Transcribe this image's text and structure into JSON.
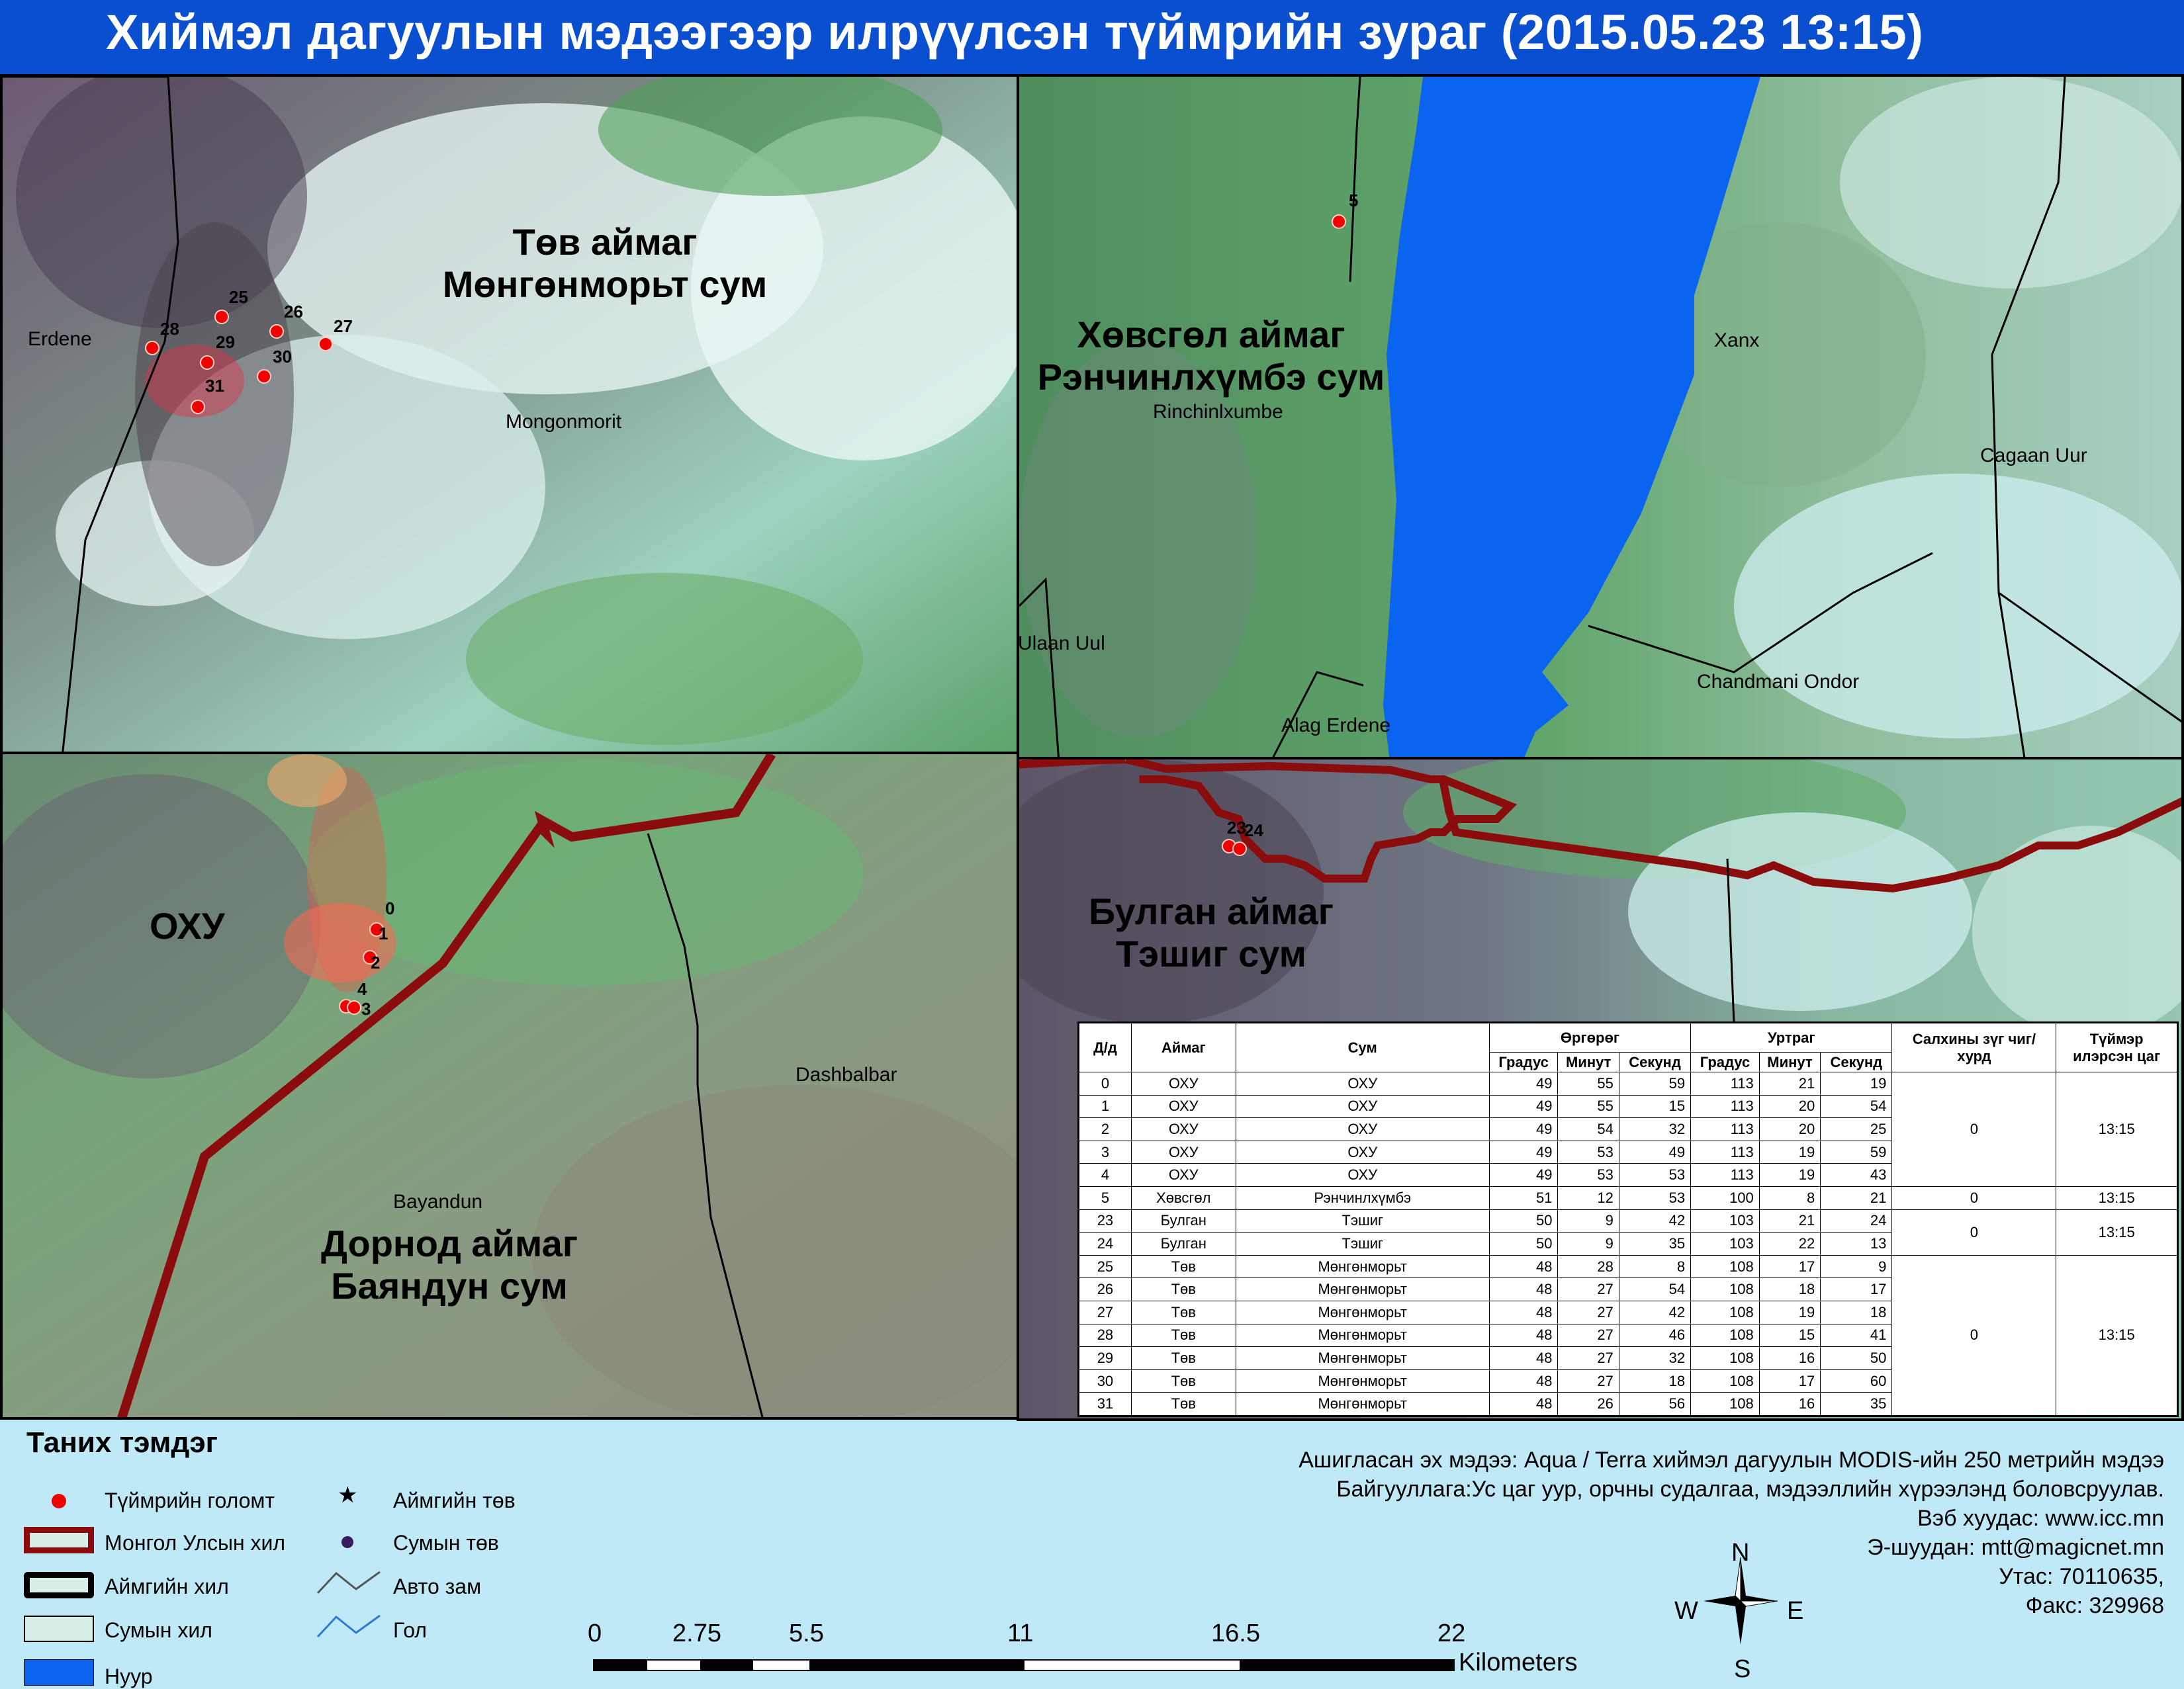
{
  "title": "Хиймэл дагуулын мэдээгээр илрүүлсэн түймрийн зураг  (2015.05.23 13:15)",
  "panels": {
    "tl": {
      "region": [
        "Төв аймаг",
        "Мөнгөнморьт сум"
      ],
      "places": [
        "Erdene",
        "Mongonmorit"
      ],
      "fires": [
        "25",
        "26",
        "27",
        "28",
        "29",
        "30",
        "31"
      ]
    },
    "tr": {
      "region": [
        "Хөвсгөл аймаг",
        "Рэнчинлхүмбэ сум"
      ],
      "places": [
        "Rinchinlxumbe",
        "Xanx",
        "Cagaan Uur",
        "Ulaan Uul",
        "Chandmani Ondor",
        "Alag Erdene"
      ],
      "fires": [
        "5"
      ]
    },
    "bl": {
      "region": [
        "Дорнод аймаг",
        "Баяндун сум"
      ],
      "country": "ОХУ",
      "places": [
        "Dashbalbar",
        "Bayandun"
      ],
      "fires": [
        "0",
        "1",
        "2",
        "4",
        "3"
      ]
    },
    "br": {
      "region": [
        "Булган аймаг",
        "Тэшиг сум"
      ],
      "fires": [
        "23",
        "24"
      ]
    }
  },
  "table": {
    "headers": {
      "dd": "Д/д",
      "aimag": "Аймаг",
      "sum": "Сум",
      "lat": "Өргөрөг",
      "lon": "Уртраг",
      "deg": "Градус",
      "min": "Минут",
      "sec": "Секунд",
      "wind": "Салхины зүг чиг/хурд",
      "time": "Түймэр илэрсэн цаг"
    },
    "rows": [
      [
        "0",
        "ОХУ",
        "ОХУ",
        "49",
        "55",
        "59",
        "113",
        "21",
        "19"
      ],
      [
        "1",
        "ОХУ",
        "ОХУ",
        "49",
        "55",
        "15",
        "113",
        "20",
        "54"
      ],
      [
        "2",
        "ОХУ",
        "ОХУ",
        "49",
        "54",
        "32",
        "113",
        "20",
        "25"
      ],
      [
        "3",
        "ОХУ",
        "ОХУ",
        "49",
        "53",
        "49",
        "113",
        "19",
        "59"
      ],
      [
        "4",
        "ОХУ",
        "ОХУ",
        "49",
        "53",
        "53",
        "113",
        "19",
        "43"
      ],
      [
        "5",
        "Хөвсгөл",
        "Рэнчинлхүмбэ",
        "51",
        "12",
        "53",
        "100",
        "8",
        "21"
      ],
      [
        "23",
        "Булган",
        "Тэшиг",
        "50",
        "9",
        "42",
        "103",
        "21",
        "24"
      ],
      [
        "24",
        "Булган",
        "Тэшиг",
        "50",
        "9",
        "35",
        "103",
        "22",
        "13"
      ],
      [
        "25",
        "Төв",
        "Мөнгөнморьт",
        "48",
        "28",
        "8",
        "108",
        "17",
        "9"
      ],
      [
        "26",
        "Төв",
        "Мөнгөнморьт",
        "48",
        "27",
        "54",
        "108",
        "18",
        "17"
      ],
      [
        "27",
        "Төв",
        "Мөнгөнморьт",
        "48",
        "27",
        "42",
        "108",
        "19",
        "18"
      ],
      [
        "28",
        "Төв",
        "Мөнгөнморьт",
        "48",
        "27",
        "46",
        "108",
        "15",
        "41"
      ],
      [
        "29",
        "Төв",
        "Мөнгөнморьт",
        "48",
        "27",
        "32",
        "108",
        "16",
        "50"
      ],
      [
        "30",
        "Төв",
        "Мөнгөнморьт",
        "48",
        "27",
        "18",
        "108",
        "17",
        "60"
      ],
      [
        "31",
        "Төв",
        "Мөнгөнморьт",
        "48",
        "26",
        "56",
        "108",
        "16",
        "35"
      ]
    ],
    "groups": [
      {
        "wind": "0",
        "time": "13:15"
      },
      {
        "wind": "0",
        "time": "13:15"
      },
      {
        "wind": "0",
        "time": "13:15"
      },
      {
        "wind": "0",
        "time": "13:15"
      }
    ]
  },
  "legend": {
    "title": "Таних тэмдэг",
    "items": [
      "Түймрийн голомт",
      "Монгол Улсын хил",
      "Аймгийн хил",
      "Сумын хил",
      "Нуур",
      "Аймгийн төв",
      "Сумын төв",
      "Авто зам",
      "Гол"
    ]
  },
  "info": [
    "Ашигласан эх мэдээ: Aqua / Terra хиймэл дагуулын MODIS-ийн 250 метрийн мэдээ",
    "Байгууллага:Ус цаг уур, орчны судалгаа, мэдээллийн хүрээлэнд боловсруулав.",
    "Вэб хуудас: www.icc.mn",
    "Э-шуудан: mtt@magicnet.mn",
    "Утас: 70110635,",
    "Факс: 329968"
  ],
  "scale": {
    "ticks": [
      "0",
      "2.75",
      "5.5",
      "11",
      "16.5",
      "22"
    ],
    "unit": "Kilometers"
  },
  "compass": {
    "n": "N",
    "s": "S",
    "e": "E",
    "w": "W"
  }
}
